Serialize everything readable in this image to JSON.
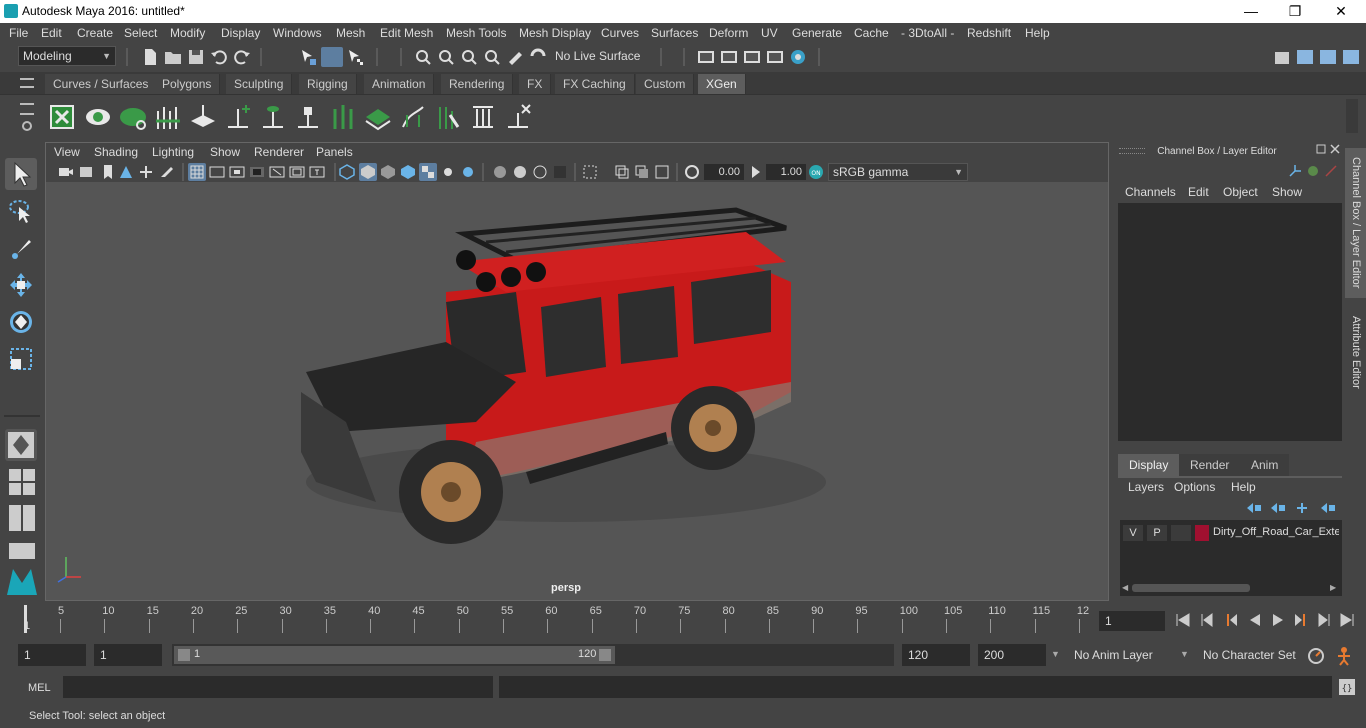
{
  "window": {
    "title": "Autodesk Maya 2016: untitled*",
    "minimize": "—",
    "restore": "❐",
    "close": "✕"
  },
  "menubar": [
    "File",
    "Edit",
    "Create",
    "Select",
    "Modify",
    "Display",
    "Windows",
    "Mesh",
    "Edit Mesh",
    "Mesh Tools",
    "Mesh Display",
    "Curves",
    "Surfaces",
    "Deform",
    "UV",
    "Generate",
    "Cache",
    "- 3DtoAll -",
    "Redshift",
    "Help"
  ],
  "statusline": {
    "mode": "Modeling",
    "live_surface": "No Live Surface"
  },
  "shelf": {
    "tabs": [
      "Curves / Surfaces",
      "Polygons",
      "Sculpting",
      "Rigging",
      "Animation",
      "Rendering",
      "FX",
      "FX Caching",
      "Custom",
      "XGen"
    ],
    "active_tab": "XGen"
  },
  "viewport": {
    "menu": [
      "View",
      "Shading",
      "Lighting",
      "Show",
      "Renderer",
      "Panels"
    ],
    "exposure": "0.00",
    "gamma": "1.00",
    "color_space": "sRGB gamma",
    "camera": "persp"
  },
  "channelbox": {
    "title": "Channel Box / Layer Editor",
    "menu": [
      "Channels",
      "Edit",
      "Object",
      "Show"
    ],
    "layer_tabs": [
      "Display",
      "Render",
      "Anim"
    ],
    "active_layer_tab": "Display",
    "layer_menu": [
      "Layers",
      "Options",
      "Help"
    ],
    "layers": [
      {
        "v": "V",
        "p": "P",
        "name": "Dirty_Off_Road_Car_Exte",
        "color": "#a01030"
      }
    ]
  },
  "side_tabs": [
    "Channel Box / Layer Editor",
    "Attribute Editor"
  ],
  "timeslider": {
    "ticks": [
      "5",
      "10",
      "15",
      "20",
      "25",
      "30",
      "35",
      "40",
      "45",
      "50",
      "55",
      "60",
      "65",
      "70",
      "75",
      "80",
      "85",
      "90",
      "95",
      "100",
      "105",
      "110",
      "115",
      "12"
    ],
    "start_label": "1",
    "current_frame": "1"
  },
  "rangeslider": {
    "start": "1",
    "playback_start": "1",
    "range_start": "1",
    "range_end": "120",
    "playback_end": "120",
    "end": "200",
    "anim_layer": "No Anim Layer",
    "character_set": "No Character Set"
  },
  "cmdline": {
    "label": "MEL"
  },
  "helpline": {
    "text": "Select Tool: select an object"
  }
}
